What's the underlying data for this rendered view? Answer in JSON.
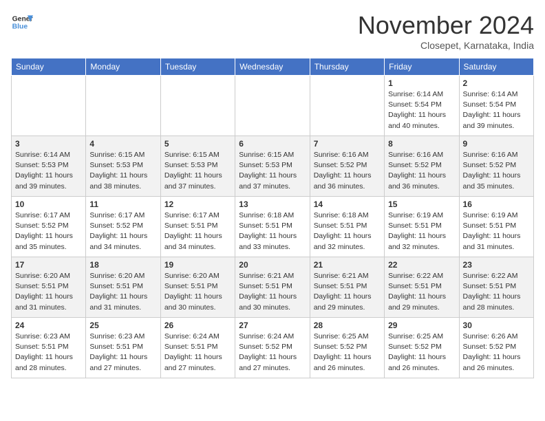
{
  "header": {
    "logo_line1": "General",
    "logo_line2": "Blue",
    "month_title": "November 2024",
    "location": "Closepet, Karnataka, India"
  },
  "weekdays": [
    "Sunday",
    "Monday",
    "Tuesday",
    "Wednesday",
    "Thursday",
    "Friday",
    "Saturday"
  ],
  "weeks": [
    [
      {
        "day": "",
        "info": ""
      },
      {
        "day": "",
        "info": ""
      },
      {
        "day": "",
        "info": ""
      },
      {
        "day": "",
        "info": ""
      },
      {
        "day": "",
        "info": ""
      },
      {
        "day": "1",
        "info": "Sunrise: 6:14 AM\nSunset: 5:54 PM\nDaylight: 11 hours\nand 40 minutes."
      },
      {
        "day": "2",
        "info": "Sunrise: 6:14 AM\nSunset: 5:54 PM\nDaylight: 11 hours\nand 39 minutes."
      }
    ],
    [
      {
        "day": "3",
        "info": "Sunrise: 6:14 AM\nSunset: 5:53 PM\nDaylight: 11 hours\nand 39 minutes."
      },
      {
        "day": "4",
        "info": "Sunrise: 6:15 AM\nSunset: 5:53 PM\nDaylight: 11 hours\nand 38 minutes."
      },
      {
        "day": "5",
        "info": "Sunrise: 6:15 AM\nSunset: 5:53 PM\nDaylight: 11 hours\nand 37 minutes."
      },
      {
        "day": "6",
        "info": "Sunrise: 6:15 AM\nSunset: 5:53 PM\nDaylight: 11 hours\nand 37 minutes."
      },
      {
        "day": "7",
        "info": "Sunrise: 6:16 AM\nSunset: 5:52 PM\nDaylight: 11 hours\nand 36 minutes."
      },
      {
        "day": "8",
        "info": "Sunrise: 6:16 AM\nSunset: 5:52 PM\nDaylight: 11 hours\nand 36 minutes."
      },
      {
        "day": "9",
        "info": "Sunrise: 6:16 AM\nSunset: 5:52 PM\nDaylight: 11 hours\nand 35 minutes."
      }
    ],
    [
      {
        "day": "10",
        "info": "Sunrise: 6:17 AM\nSunset: 5:52 PM\nDaylight: 11 hours\nand 35 minutes."
      },
      {
        "day": "11",
        "info": "Sunrise: 6:17 AM\nSunset: 5:52 PM\nDaylight: 11 hours\nand 34 minutes."
      },
      {
        "day": "12",
        "info": "Sunrise: 6:17 AM\nSunset: 5:51 PM\nDaylight: 11 hours\nand 34 minutes."
      },
      {
        "day": "13",
        "info": "Sunrise: 6:18 AM\nSunset: 5:51 PM\nDaylight: 11 hours\nand 33 minutes."
      },
      {
        "day": "14",
        "info": "Sunrise: 6:18 AM\nSunset: 5:51 PM\nDaylight: 11 hours\nand 32 minutes."
      },
      {
        "day": "15",
        "info": "Sunrise: 6:19 AM\nSunset: 5:51 PM\nDaylight: 11 hours\nand 32 minutes."
      },
      {
        "day": "16",
        "info": "Sunrise: 6:19 AM\nSunset: 5:51 PM\nDaylight: 11 hours\nand 31 minutes."
      }
    ],
    [
      {
        "day": "17",
        "info": "Sunrise: 6:20 AM\nSunset: 5:51 PM\nDaylight: 11 hours\nand 31 minutes."
      },
      {
        "day": "18",
        "info": "Sunrise: 6:20 AM\nSunset: 5:51 PM\nDaylight: 11 hours\nand 31 minutes."
      },
      {
        "day": "19",
        "info": "Sunrise: 6:20 AM\nSunset: 5:51 PM\nDaylight: 11 hours\nand 30 minutes."
      },
      {
        "day": "20",
        "info": "Sunrise: 6:21 AM\nSunset: 5:51 PM\nDaylight: 11 hours\nand 30 minutes."
      },
      {
        "day": "21",
        "info": "Sunrise: 6:21 AM\nSunset: 5:51 PM\nDaylight: 11 hours\nand 29 minutes."
      },
      {
        "day": "22",
        "info": "Sunrise: 6:22 AM\nSunset: 5:51 PM\nDaylight: 11 hours\nand 29 minutes."
      },
      {
        "day": "23",
        "info": "Sunrise: 6:22 AM\nSunset: 5:51 PM\nDaylight: 11 hours\nand 28 minutes."
      }
    ],
    [
      {
        "day": "24",
        "info": "Sunrise: 6:23 AM\nSunset: 5:51 PM\nDaylight: 11 hours\nand 28 minutes."
      },
      {
        "day": "25",
        "info": "Sunrise: 6:23 AM\nSunset: 5:51 PM\nDaylight: 11 hours\nand 27 minutes."
      },
      {
        "day": "26",
        "info": "Sunrise: 6:24 AM\nSunset: 5:51 PM\nDaylight: 11 hours\nand 27 minutes."
      },
      {
        "day": "27",
        "info": "Sunrise: 6:24 AM\nSunset: 5:52 PM\nDaylight: 11 hours\nand 27 minutes."
      },
      {
        "day": "28",
        "info": "Sunrise: 6:25 AM\nSunset: 5:52 PM\nDaylight: 11 hours\nand 26 minutes."
      },
      {
        "day": "29",
        "info": "Sunrise: 6:25 AM\nSunset: 5:52 PM\nDaylight: 11 hours\nand 26 minutes."
      },
      {
        "day": "30",
        "info": "Sunrise: 6:26 AM\nSunset: 5:52 PM\nDaylight: 11 hours\nand 26 minutes."
      }
    ]
  ]
}
